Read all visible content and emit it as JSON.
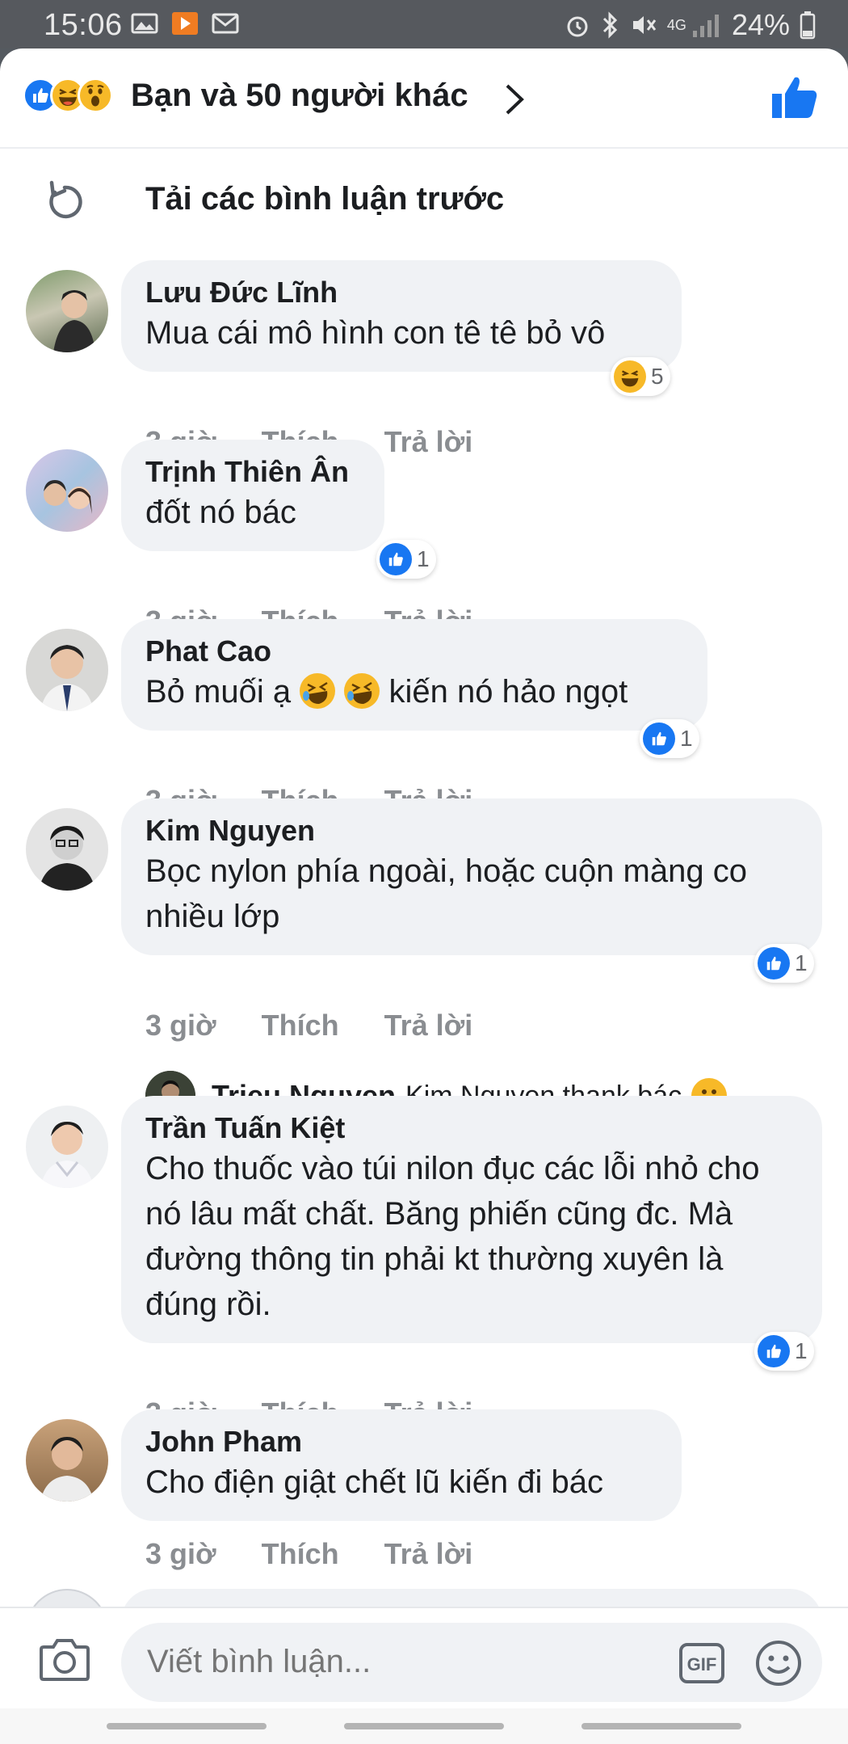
{
  "status_bar": {
    "time": "15:06",
    "network": "4G",
    "battery": "24%",
    "icons": [
      "gallery-icon",
      "play-icon",
      "gmail-icon",
      "alarm-icon",
      "bluetooth-icon",
      "mute-icon",
      "signal-icon",
      "battery-icon"
    ]
  },
  "header": {
    "reactions": [
      "like",
      "haha",
      "wow"
    ],
    "summary": "Bạn và 50 người khác"
  },
  "load_previous": "Tải các bình luận trước",
  "comments": [
    {
      "author": "Lưu Đức Lĩnh",
      "text": "Mua cái mô hình con tê tê bỏ vô",
      "time": "3 giờ",
      "like": "Thích",
      "reply": "Trả lời",
      "reaction": "haha",
      "reaction_count": "5"
    },
    {
      "author": "Trịnh Thiên Ân",
      "text": "đốt nó bác",
      "time": "3 giờ",
      "like": "Thích",
      "reply": "Trả lời",
      "reaction": "like",
      "reaction_count": "1"
    },
    {
      "author": "Phat Cao",
      "text_before": "Bỏ muối ạ",
      "text_after": "kiến nó hảo ngọt",
      "emoji": "rofl",
      "time": "3 giờ",
      "like": "Thích",
      "reply": "Trả lời",
      "reaction": "like",
      "reaction_count": "1"
    },
    {
      "author": "Kim Nguyen",
      "text": "Bọc nylon phía ngoài, hoặc cuộn màng co nhiều lớp",
      "time": "3 giờ",
      "like": "Thích",
      "reply": "Trả lời",
      "reaction": "like",
      "reaction_count": "1"
    },
    {
      "author": "Trần Tuấn Kiệt",
      "text": "Cho thuốc vào túi nilon đục các lỗi nhỏ cho nó lâu mất chất. Băng phiến cũng đc. Mà đường thông tin phải kt thường xuyên là đúng rồi.",
      "time": "3 giờ",
      "like": "Thích",
      "reply": "Trả lời",
      "reaction": "like",
      "reaction_count": "1"
    },
    {
      "author": "John Pham",
      "text": "Cho điện giật chết lũ kiến đi bác",
      "time": "3 giờ",
      "like": "Thích",
      "reply": "Trả lời"
    }
  ],
  "reply_preview": {
    "author": "Trieu Nguyen",
    "text": "Kim Nguyen thank bác",
    "emoji": "smile"
  },
  "composer": {
    "placeholder": "Viết bình luận...",
    "gif_label": "GIF"
  },
  "colors": {
    "like_blue": "#1877f2",
    "emoji_yellow": "#f7b928",
    "bubble": "#f0f2f5",
    "meta_gray": "#8a8d91"
  }
}
